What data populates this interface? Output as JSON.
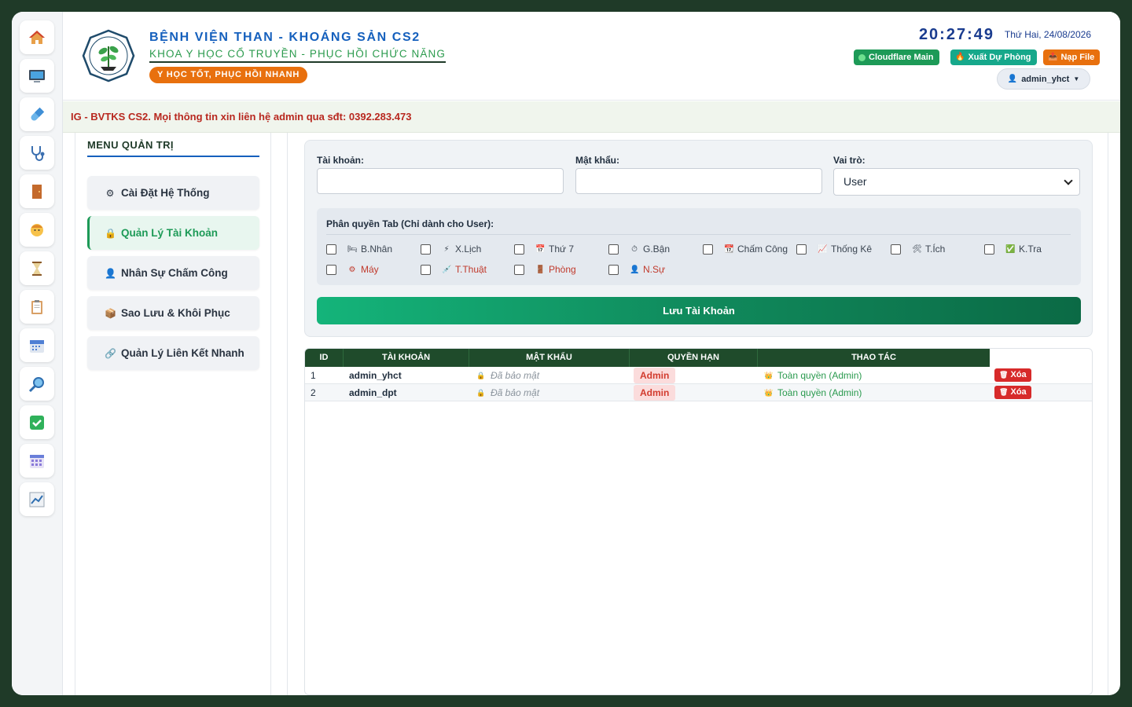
{
  "sidebar": {
    "icons": [
      "home-icon",
      "monitor-icon",
      "pill-icon",
      "stethoscope-icon",
      "door-icon",
      "person-icon",
      "hourglass-icon",
      "clipboard-icon",
      "calendar-icon",
      "search-icon",
      "check-icon",
      "calendar-grid-icon",
      "chart-icon"
    ]
  },
  "header": {
    "hospital_name": "BỆNH VIỆN THAN - KHOÁNG SẢN CS2",
    "department": "KHOA Y HỌC CỔ TRUYỀN - PHỤC HỒI CHỨC NĂNG",
    "slogan": "Y HỌC TỐT, PHỤC HỒI NHANH",
    "clock": "20:27:49",
    "date": "Thứ Hai, 24/08/2026",
    "btn_cloudflare": "Cloudflare Main",
    "btn_backup": "Xuất Dự Phòng",
    "btn_upload": "Nạp File",
    "user": "admin_yhct",
    "colors": {
      "green": "#1d9a57",
      "teal": "#16a88b",
      "orange": "#e8700e"
    }
  },
  "marquee": {
    "text": "IG - BVTKS CS2. Mọi thông tin xin liên hệ admin qua sđt: 0392.283.473"
  },
  "menu": {
    "title": "MENU QUẢN TRỊ",
    "items": [
      {
        "label": "Cài Đặt Hệ Thống",
        "icon": "gear-icon",
        "glyph": "⚙"
      },
      {
        "label": "Quản Lý Tài Khoản",
        "icon": "lock-icon",
        "glyph": "🔒"
      },
      {
        "label": "Nhân Sự Chấm Công",
        "icon": "person-icon",
        "glyph": "👤"
      },
      {
        "label": "Sao Lưu & Khôi Phục",
        "icon": "box-icon",
        "glyph": "📦"
      },
      {
        "label": "Quản Lý Liên Kết Nhanh",
        "icon": "link-icon",
        "glyph": "🔗"
      }
    ]
  },
  "form": {
    "username_label": "Tài khoản:",
    "password_label": "Mật khẩu:",
    "role_label": "Vai trò:",
    "role_value": "User",
    "perm_title": "Phân quyền Tab (Chỉ dành cho User):",
    "perms": [
      {
        "label": "B.Nhân",
        "glyph": "🛏"
      },
      {
        "label": "X.Lịch",
        "glyph": "⚡"
      },
      {
        "label": "Thứ 7",
        "glyph": "📅"
      },
      {
        "label": "G.Bận",
        "glyph": "⏱"
      },
      {
        "label": "Chấm Công",
        "glyph": "📆"
      },
      {
        "label": "Thống Kê",
        "glyph": "📈"
      },
      {
        "label": "T.Ích",
        "glyph": "🛠"
      },
      {
        "label": "K.Tra",
        "glyph": "✅"
      },
      {
        "label": "Máy",
        "glyph": "⚙"
      },
      {
        "label": "T.Thuật",
        "glyph": "💉"
      },
      {
        "label": "Phòng",
        "glyph": "🚪"
      },
      {
        "label": "N.Sự",
        "glyph": "👤"
      }
    ],
    "save_label": "Lưu Tài Khoản"
  },
  "table": {
    "headers": [
      "ID",
      "TÀI KHOẢN",
      "MẬT KHẨU",
      "QUYỀN HẠN",
      "THAO TÁC"
    ],
    "rows": [
      {
        "id": "1",
        "username": "admin_yhct",
        "password": "Đã bảo mật",
        "role": "Admin",
        "perm": "Toàn quyền (Admin)",
        "action": "Xóa"
      },
      {
        "id": "2",
        "username": "admin_dpt",
        "password": "Đã bảo mật",
        "role": "Admin",
        "perm": "Toàn quyền (Admin)",
        "action": "Xóa"
      }
    ]
  }
}
